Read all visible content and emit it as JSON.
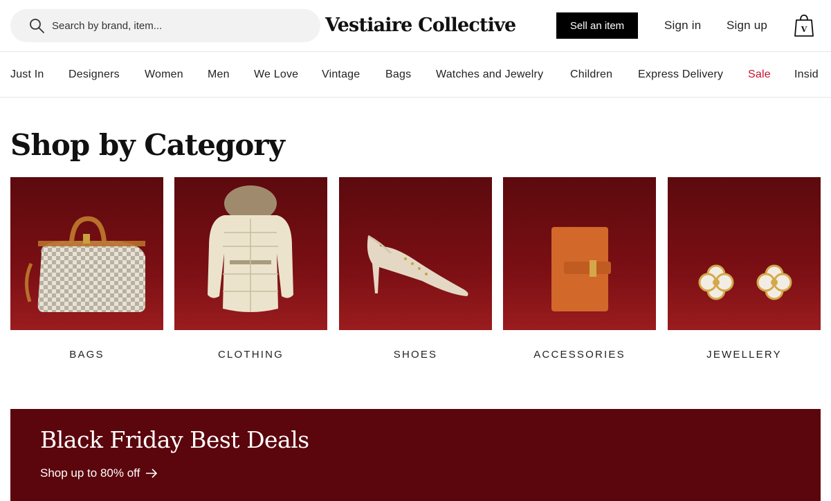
{
  "header": {
    "search_placeholder": "Search by brand, item...",
    "logo": "Vestiaire Collective",
    "sell_label": "Sell an item",
    "sign_in": "Sign in",
    "sign_up": "Sign up"
  },
  "nav": {
    "items": [
      {
        "label": "Just In"
      },
      {
        "label": "Designers"
      },
      {
        "label": "Women"
      },
      {
        "label": "Men"
      },
      {
        "label": "We Love"
      },
      {
        "label": "Vintage"
      },
      {
        "label": "Bags"
      },
      {
        "label": "Watches and Jewelry"
      },
      {
        "label": "Children"
      },
      {
        "label": "Express Delivery"
      },
      {
        "label": "Sale",
        "color": "#c8102e"
      },
      {
        "label": "Insid"
      }
    ]
  },
  "category_section": {
    "title": "Shop by Category",
    "categories": [
      {
        "label": "BAGS",
        "icon": "speedy-bag-icon"
      },
      {
        "label": "CLOTHING",
        "icon": "puffer-jacket-icon"
      },
      {
        "label": "SHOES",
        "icon": "slingback-pump-icon"
      },
      {
        "label": "ACCESSORIES",
        "icon": "wallet-icon"
      },
      {
        "label": "JEWELLERY",
        "icon": "clover-earrings-icon"
      }
    ]
  },
  "banner": {
    "title": "Black Friday Best Deals",
    "link": "Shop up to 80% off"
  },
  "colors": {
    "banner_bg": "#5b050c",
    "card_bg": "#7a0f14",
    "sale": "#c8102e"
  }
}
